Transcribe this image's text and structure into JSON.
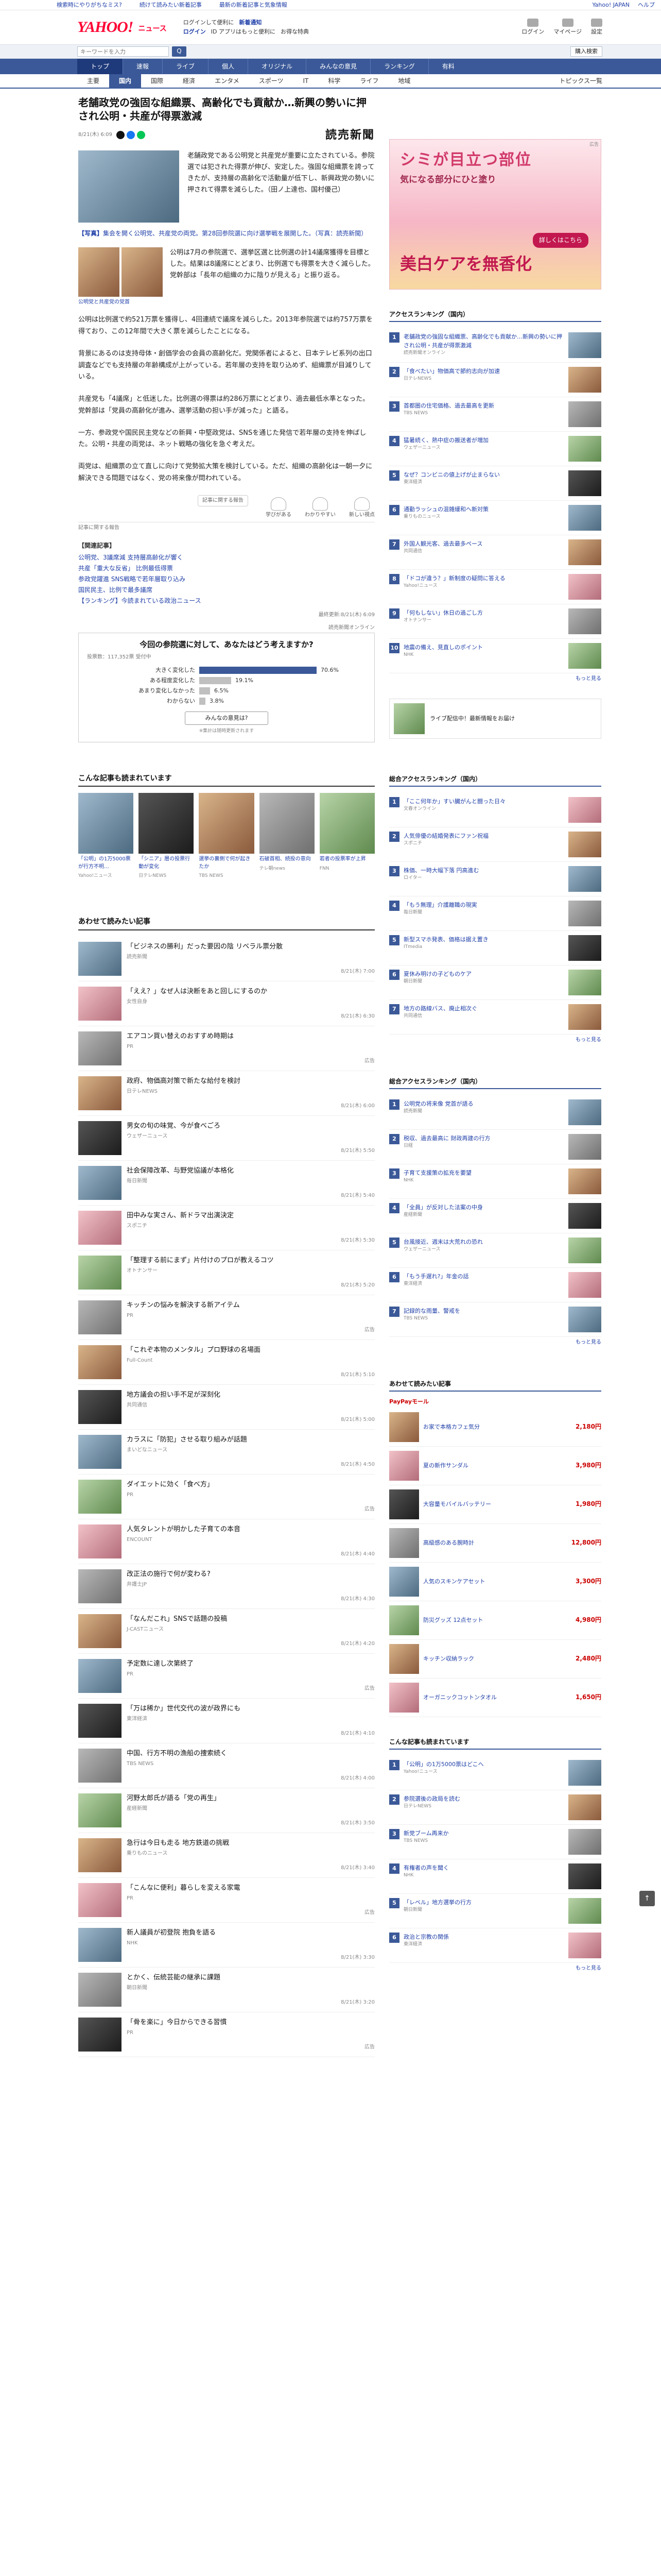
{
  "strip": {
    "items": [
      "検索時にやりがちなミス?",
      "続けて読みたい新着記事",
      "最新の新着記事と気象情報"
    ],
    "right": [
      "Yahoo! JAPAN",
      "ヘルプ"
    ]
  },
  "header": {
    "logo": "YAHOO!",
    "section": "ニュース",
    "row1": [
      "ログインして便利に",
      "新着通知"
    ],
    "row2": [
      "ログイン",
      "ID アプリはもっと便利に",
      "お得な特典"
    ],
    "right": [
      "ログイン",
      "マイページ",
      "設定"
    ]
  },
  "search": {
    "placeholder": "キーワードを入力",
    "submit": "Q",
    "button2": "購入検索"
  },
  "nav1": [
    "トップ",
    "速報",
    "ライブ",
    "個人",
    "オリジナル",
    "みんなの意見",
    "ランキング",
    "有料"
  ],
  "nav2": [
    "主要",
    "国内",
    "国際",
    "経済",
    "エンタメ",
    "スポーツ",
    "IT",
    "科学",
    "ライフ",
    "地域"
  ],
  "nav2_topics": "トピックス一覧",
  "article": {
    "title": "老舗政党の強固な組織票、高齢化でも貢献か…新興の勢いに押され公明・共産が得票激減",
    "date": "8/21(木) 6:09",
    "source": "読売新聞",
    "lead": "老舗政党である公明党と共産党が重要に立たされている。参院選では犯された得票が伸び、安定した。強固な組織票を誇ってきたが、支持層の高齢化で活動量が低下し、新興政党の勢いに押されて得票を減らした。（田ノ上達也、国村優己）",
    "caption_bold": "【写真】",
    "caption": "集会を開く公明党、共産党の両党。第28回参院選に向け選挙戦を展開した。（写真：読売新聞）",
    "rel_p": "公明は7月の参院選で、選挙区選と比例選の計14議席獲得を目標とした。結果は8議席にとどまり、比例選でも得票を大きく減らした。党幹部は「長年の組織の力に陰りが見える」と振り返る。",
    "rel_cap": "公明党と共産党の党首",
    "paras": [
      "公明は比例選で約521万票を獲得し、4回連続で議席を減らした。2013年参院選では約757万票を得ており、この12年間で大きく票を減らしたことになる。",
      "背景にあるのは支持母体・創価学会の会員の高齢化だ。党関係者によると、日本テレビ系列の出口調査などでも支持層の年齢構成が上がっている。若年層の支持を取り込めず、組織票が目減りしている。",
      "共産党も「4議席」と低迷した。比例選の得票は約286万票にとどまり、過去最低水準となった。党幹部は「党員の高齢化が進み、選挙活動の担い手が減った」と語る。",
      "一方、参政党や国民民主党などの新興・中堅政党は、SNSを通じた発信で若年層の支持を伸ばした。公明・共産の両党は、ネット戦略の強化を急ぐ考えだ。",
      "両党は、組織票の立て直しに向けて党勢拡大策を検討している。ただ、組織の高齢化は一朝一夕に解決できる問題ではなく、党の将来像が問われている。"
    ],
    "react_note": "記事に関する報告",
    "react": [
      "学びがある",
      "わかりやすい",
      "新しい視点"
    ],
    "subtle": "記事に関する報告",
    "relnews_h": "【関連記事】",
    "relnews": [
      "公明党、3議席減 支持層高齢化が響く",
      "共産「重大な反省」 比例最低得票",
      "参政党躍進 SNS戦略で若年層取り込み",
      "国民民主、比例で最多議席",
      "【ランキング】今読まれている政治ニュース"
    ],
    "provider": [
      "最終更新:8/21(木) 6:09",
      "読売新聞オンライン"
    ]
  },
  "poll": {
    "title": "今回の参院選に対して、あなたはどう考えますか?",
    "meta": "投票数：117,352票 受付中",
    "rows": [
      {
        "label": "大きく変化した",
        "pct": "70.6%"
      },
      {
        "label": "ある程度変化した",
        "pct": "19.1%"
      },
      {
        "label": "あまり変化しなかった",
        "pct": "6.5%"
      },
      {
        "label": "わからない",
        "pct": "3.8%"
      }
    ],
    "button": "みんなの意見は?",
    "note": "※集計は随時更新されます"
  },
  "rec_h": "こんな記事も読まれています",
  "rec": [
    {
      "t": "「公明」の1万5000票が行方不明…",
      "s": "Yahoo!ニュース"
    },
    {
      "t": "「シニア」層の投票行動が変化",
      "s": "日テレNEWS"
    },
    {
      "t": "選挙の裏側で何が起きたか",
      "s": "TBS NEWS"
    },
    {
      "t": "石破首相、続投の意向",
      "s": "テレ朝news"
    },
    {
      "t": "若者の投票率が上昇",
      "s": "FNN"
    }
  ],
  "ml_h": "あわせて読みたい記事",
  "ml": [
    {
      "t": "「ビジネスの勝利」だった要因の陰 リベラル票分散",
      "s": "読売新聞",
      "r": "8/21(木) 7:00"
    },
    {
      "t": "「ええ？」なぜ人は決断をあと回しにするのか",
      "s": "女性自身",
      "r": "8/21(木) 6:30"
    },
    {
      "t": "エアコン買い替えのおすすめ時期は",
      "s": "PR",
      "r": "広告"
    },
    {
      "t": "政府、物価高対策で新たな給付を検討",
      "s": "日テレNEWS",
      "r": "8/21(木) 6:00"
    },
    {
      "t": "男女の旬の味覚、今が食べごろ",
      "s": "ウェザーニュース",
      "r": "8/21(木) 5:50"
    },
    {
      "t": "社会保障改革、与野党協議が本格化",
      "s": "毎日新聞",
      "r": "8/21(木) 5:40"
    },
    {
      "t": "田中みな実さん、新ドラマ出演決定",
      "s": "スポニチ",
      "r": "8/21(木) 5:30"
    },
    {
      "t": "「整理する前にまず」片付けのプロが教えるコツ",
      "s": "オトナンサー",
      "r": "8/21(木) 5:20"
    },
    {
      "t": "キッチンの悩みを解決する新アイテム",
      "s": "PR",
      "r": "広告"
    },
    {
      "t": "「これぞ本物のメンタル」プロ野球の名場面",
      "s": "Full-Count",
      "r": "8/21(木) 5:10"
    },
    {
      "t": "地方議会の担い手不足が深刻化",
      "s": "共同通信",
      "r": "8/21(木) 5:00"
    },
    {
      "t": "カラスに「防犯」させる取り組みが話題",
      "s": "まいどなニュース",
      "r": "8/21(木) 4:50"
    },
    {
      "t": "ダイエットに効く「食べ方」",
      "s": "PR",
      "r": "広告"
    },
    {
      "t": "人気タレントが明かした子育ての本音",
      "s": "ENCOUNT",
      "r": "8/21(木) 4:40"
    },
    {
      "t": "改正法の施行で何が変わる?",
      "s": "弁護士JP",
      "r": "8/21(木) 4:30"
    },
    {
      "t": "「なんだこれ」SNSで話題の投稿",
      "s": "J-CASTニュース",
      "r": "8/21(木) 4:20"
    },
    {
      "t": "予定数に達し次第終了",
      "s": "PR",
      "r": "広告"
    },
    {
      "t": "「万は稀か」世代交代の波が政界にも",
      "s": "東洋経済",
      "r": "8/21(木) 4:10"
    },
    {
      "t": "中国、行方不明の漁船の捜索続く",
      "s": "TBS NEWS",
      "r": "8/21(木) 4:00"
    },
    {
      "t": "河野太郎氏が語る「党の再生」",
      "s": "産経新聞",
      "r": "8/21(木) 3:50"
    },
    {
      "t": "急行は今日も走る 地方鉄道の挑戦",
      "s": "乗りものニュース",
      "r": "8/21(木) 3:40"
    },
    {
      "t": "「こんなに便利」暮らしを変える家電",
      "s": "PR",
      "r": "広告"
    },
    {
      "t": "新人議員が初登院 抱負を語る",
      "s": "NHK",
      "r": "8/21(木) 3:30"
    },
    {
      "t": "とかく、伝統芸能の継承に課題",
      "s": "朝日新聞",
      "r": "8/21(木) 3:20"
    },
    {
      "t": "「骨を楽に」今日からできる習慣",
      "s": "PR",
      "r": "広告"
    }
  ],
  "side_ad": {
    "c1": "シミが目立つ部位",
    "c2": "気になる部分にひと塗り",
    "c3": "美白ケアを無香化",
    "btn": "詳しくはこちら",
    "tag": "広告"
  },
  "rank1": {
    "h": "アクセスランキング（国内）",
    "items": [
      {
        "t": "老舗政党の強固な組織票、高齢化でも貢献か…新興の勢いに押され公明・共産が得票激減",
        "s": "読売新聞オンライン"
      },
      {
        "t": "「食べたい」物価高で節約志向が加速",
        "s": "日テレNEWS"
      },
      {
        "t": "首都圏の住宅価格、過去最高を更新",
        "s": "TBS NEWS"
      },
      {
        "t": "猛暑続く、熱中症の搬送者が増加",
        "s": "ウェザーニュース"
      },
      {
        "t": "なぜ？コンビニの値上げが止まらない",
        "s": "東洋経済"
      },
      {
        "t": "通勤ラッシュの混雑緩和へ新対策",
        "s": "乗りものニュース"
      },
      {
        "t": "外国人観光客、過去最多ペース",
        "s": "共同通信"
      },
      {
        "t": "「ドコが違う？」新制度の疑問に答える",
        "s": "Yahoo!ニュース"
      },
      {
        "t": "「何もしない」休日の過ごし方",
        "s": "オトナンサー"
      },
      {
        "t": "地震の備え、見直しのポイント",
        "s": "NHK"
      }
    ],
    "more": "もっと見る"
  },
  "promo1": "ライブ配信中！最新情報をお届け",
  "rank2": {
    "h": "総合アクセスランキング（国内）",
    "items": [
      {
        "t": "「ここ何年か」すい臓がんと闘った日々",
        "s": "文春オンライン"
      },
      {
        "t": "人気俳優の結婚発表にファン祝福",
        "s": "スポニチ"
      },
      {
        "t": "株価、一時大幅下落 円高進む",
        "s": "ロイター"
      },
      {
        "t": "「もう無理」介護離職の現実",
        "s": "毎日新聞"
      },
      {
        "t": "新型スマホ発表、価格は据え置き",
        "s": "ITmedia"
      },
      {
        "t": "夏休み明けの子どものケア",
        "s": "朝日新聞"
      },
      {
        "t": "地方の路線バス、廃止相次ぐ",
        "s": "共同通信"
      }
    ],
    "more": "もっと見る"
  },
  "rank3": {
    "h": "総合アクセスランキング（国内）",
    "items": [
      {
        "t": "公明党の将来像 党首が語る",
        "s": "読売新聞"
      },
      {
        "t": "税収、過去最高に 財政再建の行方",
        "s": "日経"
      },
      {
        "t": "子育て支援策の拡充を要望",
        "s": "NHK"
      },
      {
        "t": "「全員」が反対した法案の中身",
        "s": "産経新聞"
      },
      {
        "t": "台風接近、週末は大荒れの恐れ",
        "s": "ウェザーニュース"
      },
      {
        "t": "「もう手遅れ?」年金の話",
        "s": "東洋経済"
      },
      {
        "t": "記録的な雨量、警戒を",
        "s": "TBS NEWS"
      }
    ],
    "more": "もっと見る"
  },
  "shop": {
    "h": "あわせて読みたい記事",
    "brand": "PayPayモール",
    "items": [
      {
        "t": "お家で本格カフェ気分",
        "p": "2,180円"
      },
      {
        "t": "夏の新作サンダル",
        "p": "3,980円"
      },
      {
        "t": "大容量モバイルバッテリー",
        "p": "1,980円"
      },
      {
        "t": "高級感のある腕時計",
        "p": "12,800円"
      },
      {
        "t": "人気のスキンケアセット",
        "p": "3,300円"
      },
      {
        "t": "防災グッズ 12点セット",
        "p": "4,980円"
      },
      {
        "t": "キッチン収納ラック",
        "p": "2,480円"
      },
      {
        "t": "オーガニックコットンタオル",
        "p": "1,650円"
      }
    ]
  },
  "rank4": {
    "h": "こんな記事も読まれています",
    "items": [
      {
        "t": "「公明」の1万5000票はどこへ",
        "s": "Yahoo!ニュース"
      },
      {
        "t": "参院選後の政局を読む",
        "s": "日テレNEWS"
      },
      {
        "t": "新党ブーム再来か",
        "s": "TBS NEWS"
      },
      {
        "t": "有権者の声を聞く",
        "s": "NHK"
      },
      {
        "t": "「レベル」地方選挙の行方",
        "s": "朝日新聞"
      },
      {
        "t": "政治と宗教の関係",
        "s": "東洋経済"
      }
    ],
    "more": "もっと見る"
  },
  "totop": "↑"
}
